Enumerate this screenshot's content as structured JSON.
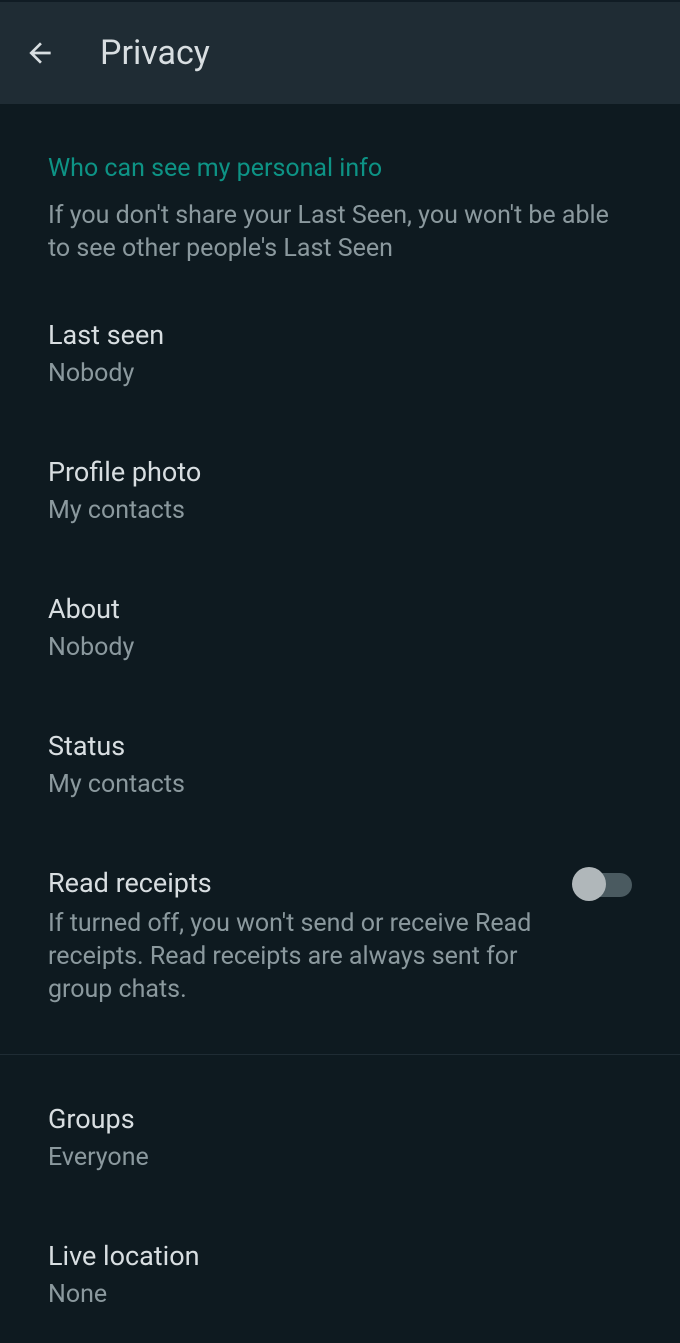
{
  "header": {
    "title": "Privacy"
  },
  "section1": {
    "title": "Who can see my personal info",
    "desc": "If you don't share your Last Seen, you won't be able to see other people's Last Seen"
  },
  "settings": {
    "lastSeen": {
      "title": "Last seen",
      "value": "Nobody"
    },
    "profilePhoto": {
      "title": "Profile photo",
      "value": "My contacts"
    },
    "about": {
      "title": "About",
      "value": "Nobody"
    },
    "status": {
      "title": "Status",
      "value": "My contacts"
    },
    "readReceipts": {
      "title": "Read receipts",
      "desc": "If turned off, you won't send or receive Read receipts. Read receipts are always sent for group chats."
    },
    "groups": {
      "title": "Groups",
      "value": "Everyone"
    },
    "liveLocation": {
      "title": "Live location",
      "value": "None"
    }
  }
}
